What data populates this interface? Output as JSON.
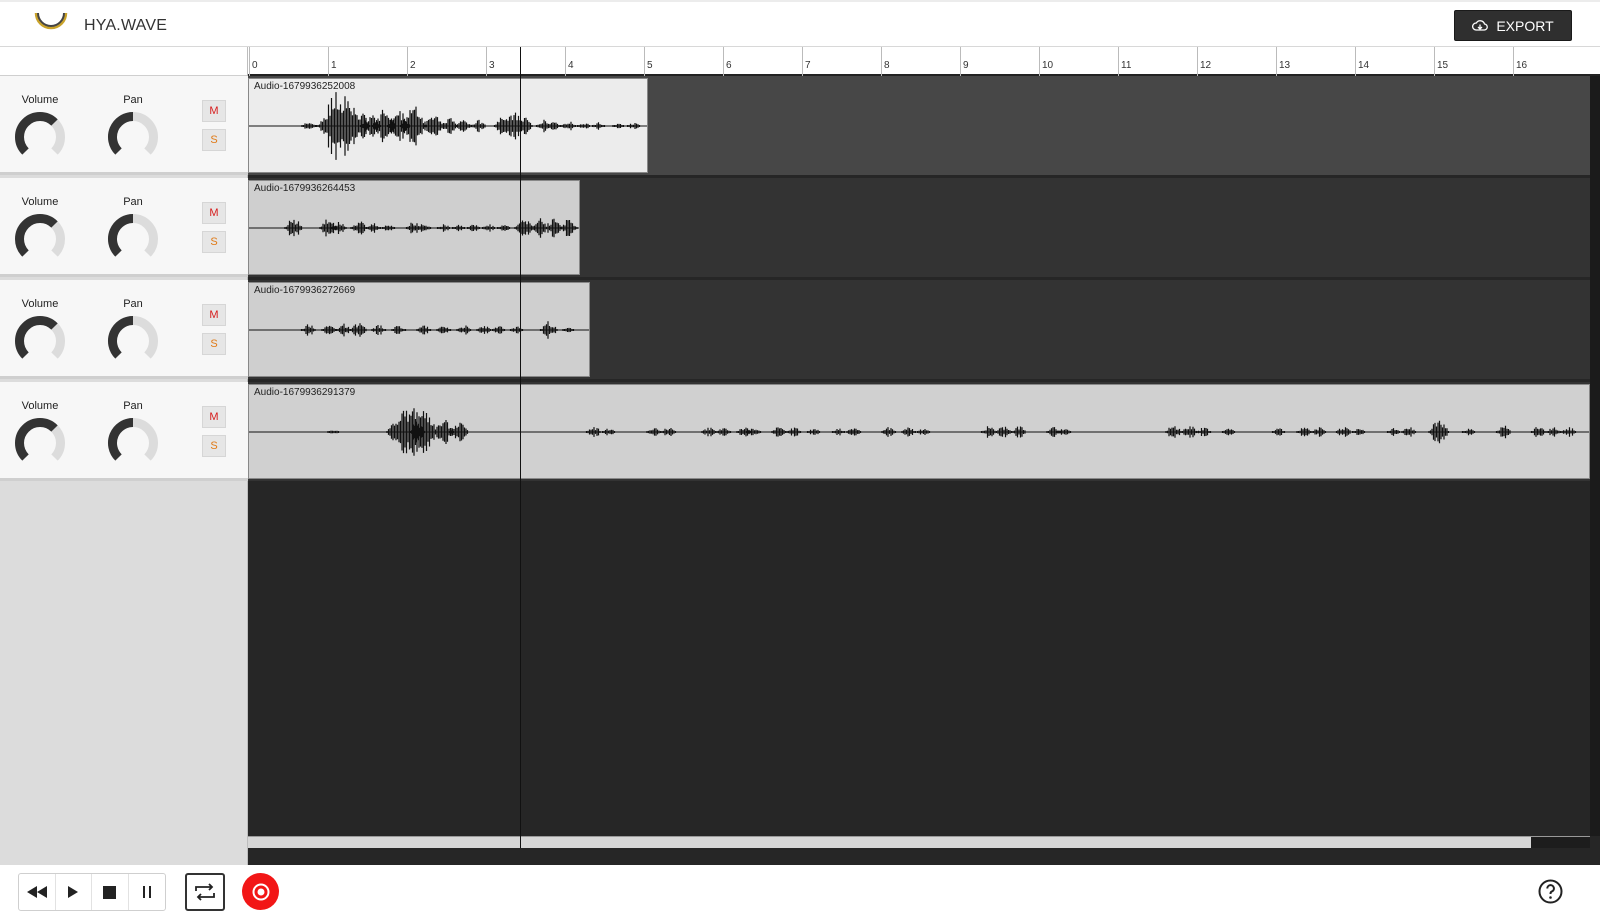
{
  "app": {
    "title": "HYA.WAVE",
    "export_label": "EXPORT"
  },
  "ruler": {
    "ticks": [
      "0",
      "1",
      "2",
      "3",
      "4",
      "5",
      "6",
      "7",
      "8",
      "9",
      "10",
      "11",
      "12",
      "13",
      "14",
      "15",
      "16"
    ]
  },
  "tracks": [
    {
      "volume_label": "Volume",
      "pan_label": "Pan",
      "mute_label": "M",
      "solo_label": "S",
      "clip_name": "Audio-1679936252008",
      "clip_color": "#ececec"
    },
    {
      "volume_label": "Volume",
      "pan_label": "Pan",
      "mute_label": "M",
      "solo_label": "S",
      "clip_name": "Audio-1679936264453",
      "clip_color": "#cfcfcf"
    },
    {
      "volume_label": "Volume",
      "pan_label": "Pan",
      "mute_label": "M",
      "solo_label": "S",
      "clip_name": "Audio-1679936272669",
      "clip_color": "#cfcfcf"
    },
    {
      "volume_label": "Volume",
      "pan_label": "Pan",
      "mute_label": "M",
      "solo_label": "S",
      "clip_name": "Audio-1679936291379",
      "clip_color": "#d0d0d0"
    }
  ],
  "transport": {
    "buttons": [
      "rewind-icon",
      "play-icon",
      "stop-icon",
      "pause-icon"
    ],
    "loop": "loop-icon",
    "record": "record-icon",
    "help": "help-icon"
  },
  "colors": {
    "accent_record": "#f21616",
    "mute": "#d61b1b",
    "solo": "#e07a17",
    "timeline_bg": "#262626"
  }
}
